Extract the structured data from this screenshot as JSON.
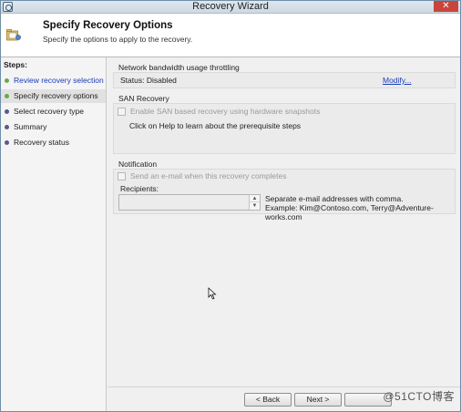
{
  "window": {
    "title": "Recovery Wizard",
    "close_label": "✕"
  },
  "header": {
    "title": "Specify Recovery Options",
    "subtitle": "Specify the options to apply to the recovery."
  },
  "steps": {
    "title": "Steps:",
    "items": [
      {
        "label": "Review recovery selection",
        "state": "done"
      },
      {
        "label": "Specify recovery options",
        "state": "current"
      },
      {
        "label": "Select recovery type",
        "state": "pending"
      },
      {
        "label": "Summary",
        "state": "pending"
      },
      {
        "label": "Recovery status",
        "state": "pending"
      }
    ]
  },
  "throttling": {
    "title": "Network bandwidth usage throttling",
    "status": "Status: Disabled",
    "modify_link": "Modify..."
  },
  "san": {
    "title": "SAN Recovery",
    "checkbox_label": "Enable SAN based recovery using hardware snapshots",
    "checkbox_checked": false,
    "help_text": "Click on Help to learn about the prerequisite steps"
  },
  "notification": {
    "title": "Notification",
    "checkbox_label": "Send an e-mail when this recovery completes",
    "checkbox_checked": false,
    "recipients_label": "Recipients:",
    "recipients_value": "",
    "note_line1": "Separate e-mail addresses with comma.",
    "note_line2": "Example: Kim@Contoso.com, Terry@Adventure-works.com"
  },
  "buttons": {
    "back": "< Back",
    "next": "Next >",
    "watermark": "@51CTO博客"
  },
  "colors": {
    "link": "#1a3db5",
    "step_done_bullet": "#6aa84f",
    "step_pending_bullet": "#5a5a8a",
    "close_button": "#c9453b"
  }
}
